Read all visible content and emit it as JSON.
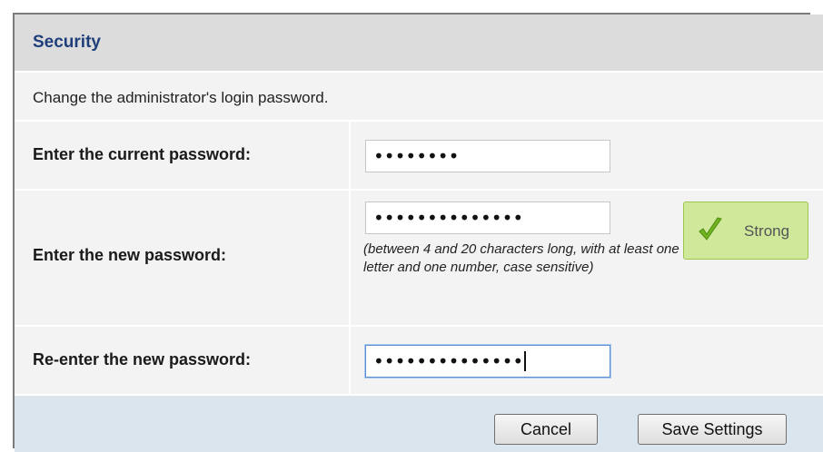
{
  "header": {
    "title": "Security"
  },
  "description": "Change the administrator's login password.",
  "fields": {
    "current": {
      "label": "Enter the current password:",
      "masked_value": "••••••••"
    },
    "new": {
      "label": "Enter the new password:",
      "masked_value": "••••••••••••••",
      "hint": "(between 4 and 20 characters long, with at least one letter and one number, case sensitive)",
      "strength_label": "Strong"
    },
    "confirm": {
      "label": "Re-enter the new password:",
      "masked_value": "••••••••••••••"
    }
  },
  "buttons": {
    "cancel": "Cancel",
    "save": "Save Settings"
  },
  "colors": {
    "header_text": "#1f3f7a",
    "strength_bg": "#cfe89a",
    "check": "#6fb31f"
  },
  "icons": {
    "strength": "checkmark-icon"
  }
}
